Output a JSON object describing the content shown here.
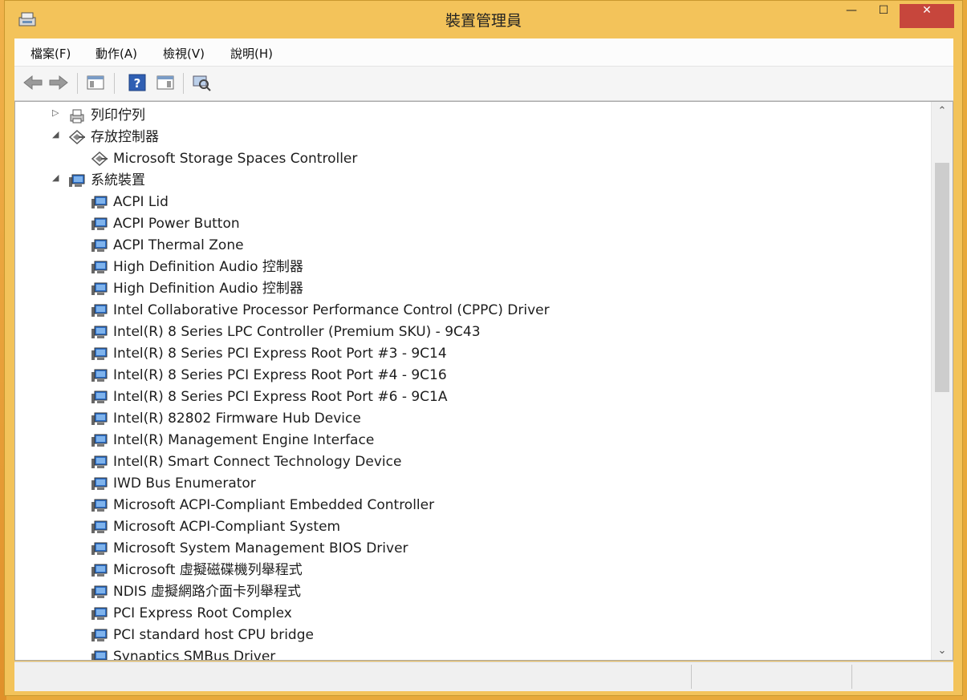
{
  "window": {
    "title": "裝置管理員",
    "controls": {
      "minimize": "—",
      "maximize": "☐",
      "close": "✕"
    }
  },
  "menubar": {
    "items": [
      {
        "label": "檔案(F)"
      },
      {
        "label": "動作(A)"
      },
      {
        "label": "檢視(V)"
      },
      {
        "label": "說明(H)"
      }
    ]
  },
  "toolbar": {
    "buttons": [
      "back-icon",
      "forward-icon",
      "properties-pane-icon",
      "help-icon",
      "action-pane-icon",
      "scan-hardware-icon"
    ]
  },
  "tree": {
    "rows": [
      {
        "label": "列印佇列",
        "expander": "▷",
        "icon": "printer-icon",
        "level": 0
      },
      {
        "label": "存放控制器",
        "expander": "◢",
        "icon": "storage-controller-icon",
        "level": 0
      },
      {
        "label": "Microsoft Storage Spaces Controller",
        "expander": "",
        "icon": "storage-controller-icon",
        "level": 1
      },
      {
        "label": "系統裝置",
        "expander": "◢",
        "icon": "system-device-icon",
        "level": 0
      },
      {
        "label": "ACPI Lid",
        "expander": "",
        "icon": "system-device-icon",
        "level": 1
      },
      {
        "label": "ACPI Power Button",
        "expander": "",
        "icon": "system-device-icon",
        "level": 1
      },
      {
        "label": "ACPI Thermal Zone",
        "expander": "",
        "icon": "system-device-icon",
        "level": 1
      },
      {
        "label": "High Definition Audio 控制器",
        "expander": "",
        "icon": "system-device-icon",
        "level": 1
      },
      {
        "label": "High Definition Audio 控制器",
        "expander": "",
        "icon": "system-device-icon",
        "level": 1
      },
      {
        "label": "Intel Collaborative Processor Performance Control (CPPC) Driver",
        "expander": "",
        "icon": "system-device-icon",
        "level": 1
      },
      {
        "label": "Intel(R) 8 Series LPC Controller (Premium SKU) - 9C43",
        "expander": "",
        "icon": "system-device-icon",
        "level": 1
      },
      {
        "label": "Intel(R) 8 Series PCI Express Root Port #3 - 9C14",
        "expander": "",
        "icon": "system-device-icon",
        "level": 1
      },
      {
        "label": "Intel(R) 8 Series PCI Express Root Port #4 - 9C16",
        "expander": "",
        "icon": "system-device-icon",
        "level": 1
      },
      {
        "label": "Intel(R) 8 Series PCI Express Root Port #6 - 9C1A",
        "expander": "",
        "icon": "system-device-icon",
        "level": 1
      },
      {
        "label": "Intel(R) 82802 Firmware Hub Device",
        "expander": "",
        "icon": "system-device-icon",
        "level": 1
      },
      {
        "label": "Intel(R) Management Engine Interface",
        "expander": "",
        "icon": "system-device-icon",
        "level": 1
      },
      {
        "label": "Intel(R) Smart Connect Technology Device",
        "expander": "",
        "icon": "system-device-icon",
        "level": 1
      },
      {
        "label": "IWD Bus Enumerator",
        "expander": "",
        "icon": "system-device-icon",
        "level": 1
      },
      {
        "label": "Microsoft ACPI-Compliant Embedded Controller",
        "expander": "",
        "icon": "system-device-icon",
        "level": 1
      },
      {
        "label": "Microsoft ACPI-Compliant System",
        "expander": "",
        "icon": "system-device-icon",
        "level": 1
      },
      {
        "label": "Microsoft System Management BIOS Driver",
        "expander": "",
        "icon": "system-device-icon",
        "level": 1
      },
      {
        "label": "Microsoft 虛擬磁碟機列舉程式",
        "expander": "",
        "icon": "system-device-icon",
        "level": 1
      },
      {
        "label": "NDIS 虛擬網路介面卡列舉程式",
        "expander": "",
        "icon": "system-device-icon",
        "level": 1
      },
      {
        "label": "PCI Express Root Complex",
        "expander": "",
        "icon": "system-device-icon",
        "level": 1
      },
      {
        "label": "PCI standard host CPU bridge",
        "expander": "",
        "icon": "system-device-icon",
        "level": 1
      },
      {
        "label": "Synaptics SMBus Driver",
        "expander": "",
        "icon": "system-device-icon",
        "level": 1
      }
    ]
  },
  "scrollbar": {
    "up": "⌃",
    "down": "⌄"
  },
  "colors": {
    "title_bar": "#f3c35a",
    "close_button": "#c7463c",
    "desktop": "#e8a93a"
  }
}
